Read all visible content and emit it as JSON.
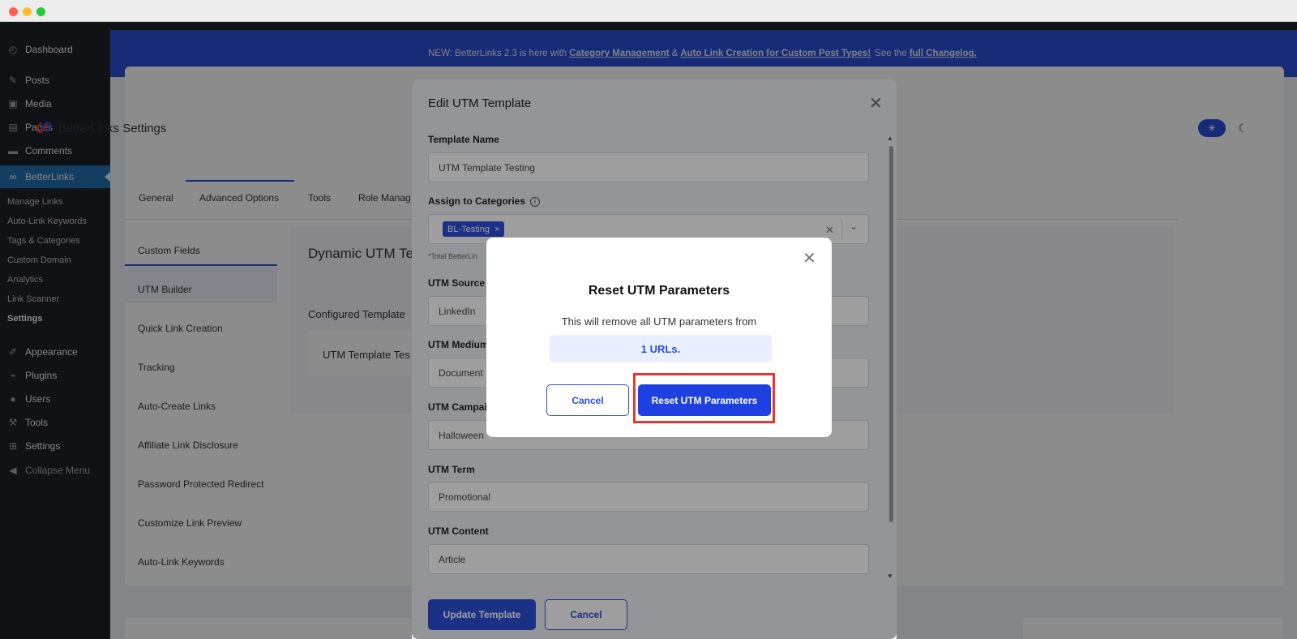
{
  "sidebar": {
    "items": [
      {
        "label": "Dashboard",
        "icon": "dashboard-icon"
      },
      {
        "label": "Posts",
        "icon": "pin-icon"
      },
      {
        "label": "Media",
        "icon": "media-icon"
      },
      {
        "label": "Pages",
        "icon": "pages-icon"
      },
      {
        "label": "Comments",
        "icon": "comment-icon"
      },
      {
        "label": "BetterLinks",
        "icon": "link-icon"
      },
      {
        "label": "Appearance",
        "icon": "brush-icon"
      },
      {
        "label": "Plugins",
        "icon": "plugin-icon"
      },
      {
        "label": "Users",
        "icon": "user-icon"
      },
      {
        "label": "Tools",
        "icon": "wrench-icon"
      },
      {
        "label": "Settings",
        "icon": "settings-icon"
      },
      {
        "label": "Collapse Menu",
        "icon": "collapse-icon"
      }
    ],
    "submenu": [
      "Manage Links",
      "Auto-Link Keywords",
      "Tags & Categories",
      "Custom Domain",
      "Analytics",
      "Link Scanner",
      "Settings"
    ]
  },
  "notice": {
    "prefix": "NEW: BetterLinks 2.3 is here with",
    "link1": "Category Management",
    "amp": "&",
    "link2": "Auto Link Creation for Custom Post Types!",
    "see": "See the",
    "link3": "full Changelog."
  },
  "settings": {
    "title": "BetterLinks Settings",
    "tabs": [
      "General",
      "Advanced Options",
      "Tools",
      "Role Manag"
    ],
    "side_nav": [
      "Custom Fields",
      "UTM Builder",
      "Quick Link Creation",
      "Tracking",
      "Auto-Create Links",
      "Affiliate Link Disclosure",
      "Password Protected Redirect",
      "Customize Link Preview",
      "Auto-Link Keywords"
    ],
    "dynamic_title": "Dynamic UTM Te",
    "configured_title": "Configured Template",
    "template_card": "UTM Template Tes"
  },
  "edit_modal": {
    "title": "Edit UTM Template",
    "template_name_label": "Template Name",
    "template_name_value": "UTM Template Testing",
    "categories_label": "Assign to Categories",
    "category_chip": "BL-Testing",
    "total_note": "*Total BetterLin",
    "utm_source_label": "UTM Source",
    "utm_source_value": "LinkedIn",
    "utm_medium_label": "UTM Medium",
    "utm_medium_value": "Document",
    "utm_campaign_label": "UTM Campaig",
    "utm_campaign_value": "Halloween",
    "utm_term_label": "UTM Term",
    "utm_term_value": "Promotional",
    "utm_content_label": "UTM Content",
    "utm_content_value": "Article",
    "update_button": "Update Template",
    "cancel_button": "Cancel"
  },
  "confirm_dialog": {
    "title": "Reset UTM Parameters",
    "message": "This will remove all UTM parameters from",
    "count": "1 URLs.",
    "cancel_button": "Cancel",
    "reset_button": "Reset UTM Parameters"
  },
  "colors": {
    "accent": "#2b4fd8",
    "highlight": "#e8382e",
    "sidebar_bg": "#1d2327"
  }
}
